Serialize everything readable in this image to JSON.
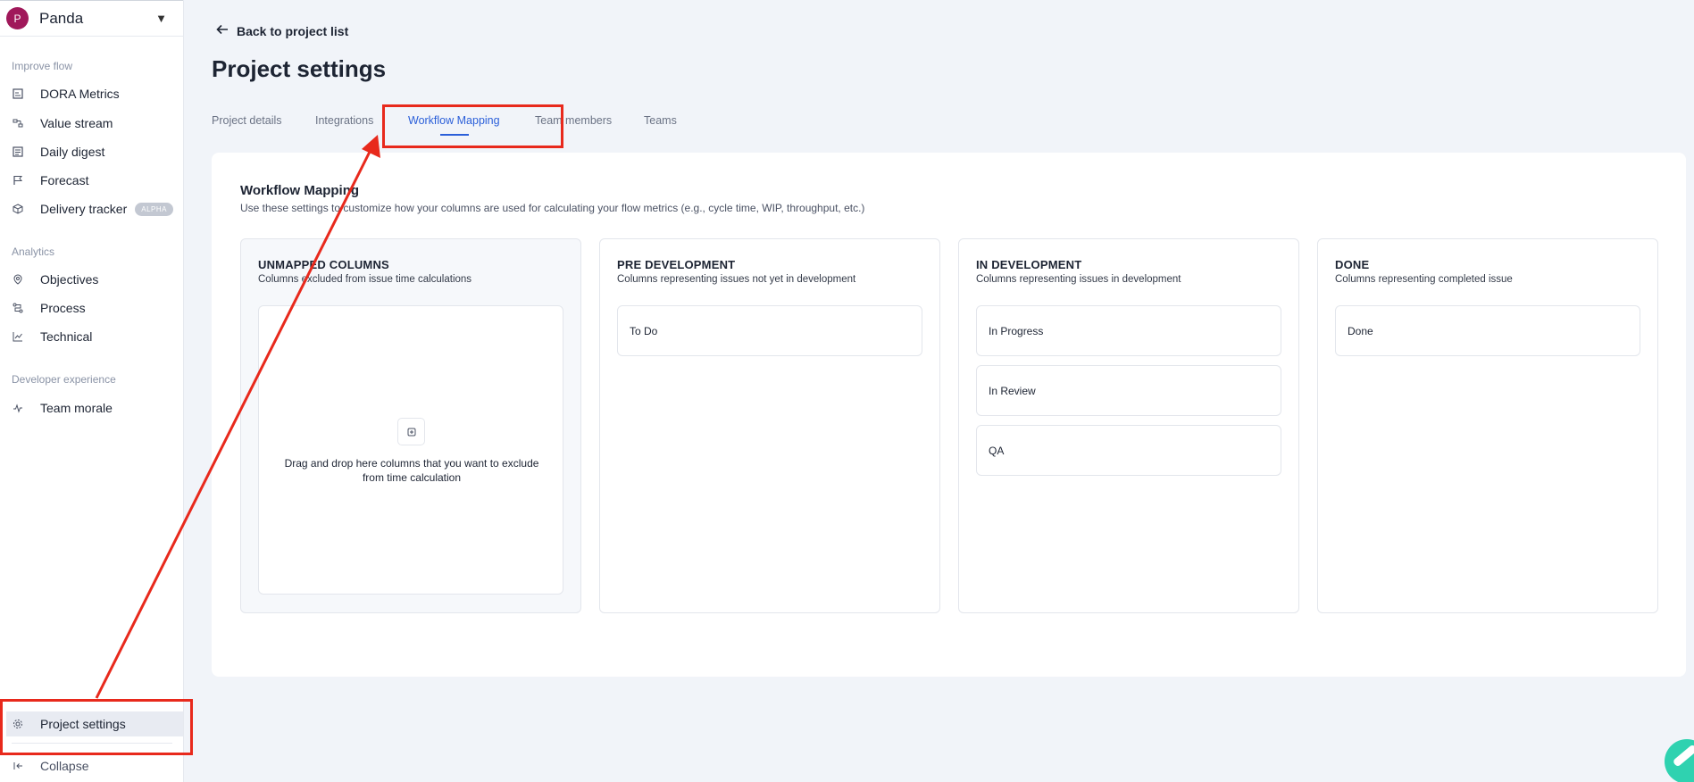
{
  "workspace": {
    "initial": "P",
    "name": "Panda",
    "caret": "▼"
  },
  "sidebar": {
    "sections": [
      {
        "label": "Improve flow"
      },
      {
        "label": "Analytics"
      },
      {
        "label": "Developer experience"
      }
    ],
    "items": [
      {
        "label": "DORA Metrics",
        "icon": "dora-metrics-icon"
      },
      {
        "label": "Value stream",
        "icon": "value-stream-icon"
      },
      {
        "label": "Daily digest",
        "icon": "daily-digest-icon"
      },
      {
        "label": "Forecast",
        "icon": "flag-icon"
      },
      {
        "label": "Delivery tracker",
        "icon": "package-icon",
        "badge": "ALPHA"
      },
      {
        "label": "Objectives",
        "icon": "target-icon"
      },
      {
        "label": "Process",
        "icon": "process-icon"
      },
      {
        "label": "Technical",
        "icon": "line-chart-icon"
      },
      {
        "label": "Team morale",
        "icon": "pulse-icon"
      }
    ],
    "settings_label": "Project settings",
    "collapse_label": "Collapse"
  },
  "header": {
    "back_label": "Back to project list",
    "title": "Project settings"
  },
  "tabs": [
    {
      "label": "Project details"
    },
    {
      "label": "Integrations"
    },
    {
      "label": "Workflow Mapping",
      "active": true
    },
    {
      "label": "Team members"
    },
    {
      "label": "Teams"
    }
  ],
  "workflow": {
    "title": "Workflow Mapping",
    "description": "Use these settings to customize how your columns are used for calculating your flow metrics (e.g., cycle time, WIP, throughput, etc.)",
    "columns": [
      {
        "title": "UNMAPPED COLUMNS",
        "subtitle": "Columns excluded from issue time calculations",
        "drop_text": "Drag and drop here columns that you want to exclude from time calculation"
      },
      {
        "title": "PRE DEVELOPMENT",
        "subtitle": "Columns representing issues not yet in development",
        "items": [
          "To Do"
        ]
      },
      {
        "title": "IN DEVELOPMENT",
        "subtitle": "Columns representing issues in development",
        "items": [
          "In Progress",
          "In Review",
          "QA"
        ]
      },
      {
        "title": "DONE",
        "subtitle": "Columns representing completed issue",
        "items": [
          "Done"
        ]
      }
    ]
  },
  "colors": {
    "accent": "#2b5fd9",
    "annotation": "#e8291c",
    "avatar": "#a0185a"
  }
}
